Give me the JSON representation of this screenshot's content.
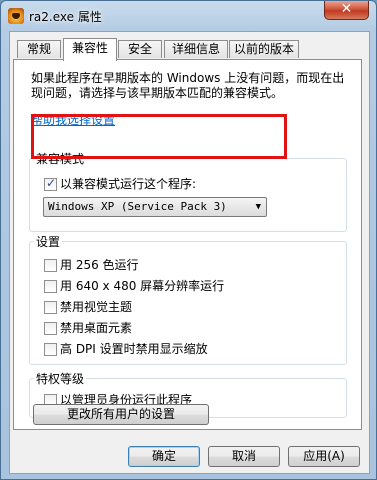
{
  "window": {
    "title": "ra2.exe 属性",
    "close_glyph": "✕"
  },
  "tabs": [
    {
      "label": "常规"
    },
    {
      "label": "兼容性"
    },
    {
      "label": "安全"
    },
    {
      "label": "详细信息"
    },
    {
      "label": "以前的版本"
    }
  ],
  "description": "如果此程序在早期版本的 Windows 上没有问题，而现在出现问题，请选择与该早期版本匹配的兼容模式。",
  "help_link": "帮助我选择设置",
  "compat_mode": {
    "title": "兼容模式",
    "checkbox_label": "以兼容模式运行这个程序:",
    "checked": true,
    "selected_os": "Windows XP (Service Pack 3)",
    "dropdown_arrow": "▼"
  },
  "settings": {
    "title": "设置",
    "items": [
      {
        "label": "用 256 色运行",
        "checked": false
      },
      {
        "label": "用 640 x 480 屏幕分辨率运行",
        "checked": false
      },
      {
        "label": "禁用视觉主题",
        "checked": false
      },
      {
        "label": "禁用桌面元素",
        "checked": false
      },
      {
        "label": "高 DPI 设置时禁用显示缩放",
        "checked": false
      }
    ]
  },
  "privilege": {
    "title": "特权等级",
    "checkbox_label": "以管理员身份运行此程序",
    "checked": false
  },
  "change_all_users_button": "更改所有用户的设置",
  "footer": {
    "ok": "确定",
    "cancel": "取消",
    "apply": "应用(A)"
  },
  "colors": {
    "highlight": "#e01212",
    "link": "#0066cc"
  }
}
